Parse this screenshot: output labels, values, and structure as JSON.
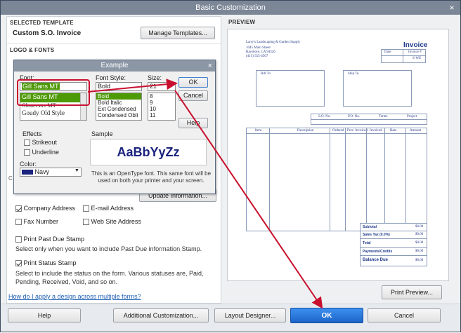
{
  "window": {
    "title": "Basic Customization",
    "close": "×"
  },
  "left": {
    "selected_template_header": "SELECTED TEMPLATE",
    "template_name": "Custom S.O. Invoice",
    "manage_templates": "Manage Templates...",
    "logo_fonts_header": "LOGO & FONTS",
    "update_information": "Update Information...",
    "options": [
      {
        "label": "Company Address",
        "checked": true
      },
      {
        "label": "E-mail Address",
        "checked": false
      },
      {
        "label": "Fax Number",
        "checked": false
      },
      {
        "label": "Web Site Address",
        "checked": false
      }
    ],
    "past_due_label": "Print Past Due Stamp",
    "past_due_checked": false,
    "past_due_desc": "Select only when you want to include Past Due information Stamp.",
    "status_label": "Print Status Stamp",
    "status_checked": true,
    "status_desc": "Select to include the status on the form. Various statuses are, Paid, Pending, Received, Void, and so on.",
    "help_link": "How do I apply a design across multiple forms?",
    "side_letter": "C"
  },
  "preview": {
    "header": "PREVIEW",
    "company": "Larry's Landscaping & Garden Supply",
    "addr1": "1045 Main Street",
    "addr2": "Bayshore, CA 94326",
    "phone": "(415) 555-4567",
    "doc_title": "Invoice",
    "date_label": "Date",
    "invoice_no_label": "Invoice #",
    "date_value": "",
    "invoice_value": "S-WE",
    "bill_to": "Bill To",
    "ship_to": "Ship To",
    "info_cols": [
      "S.O. No.",
      "P.O. No.",
      "Terms",
      "Project"
    ],
    "line_cols": [
      "Item",
      "Description",
      "Ordered",
      "Prev. Invoiced",
      "Invoiced",
      "Rate",
      "Amount"
    ],
    "totals": [
      {
        "label": "Subtotal",
        "value": "$0.00"
      },
      {
        "label": "Sales Tax  (0.0%)",
        "value": "$0.00"
      },
      {
        "label": "Total",
        "value": "$0.00"
      },
      {
        "label": "Payments/Credits",
        "value": "$0.00"
      },
      {
        "label": "Balance Due",
        "value": "$0.00"
      }
    ],
    "print_preview": "Print Preview..."
  },
  "dialog": {
    "title": "Example",
    "close": "×",
    "font_label": "Font:",
    "font_value": "Gill Sans MT",
    "fonts": [
      "Gill Sans MT",
      "Gloucester MT",
      "Goudy Old Style"
    ],
    "style_label": "Font Style:",
    "style_value": "Bold",
    "styles": [
      "Bold",
      "Bold Italic",
      "Ext Condensed",
      "Condensed Obli"
    ],
    "size_label": "Size:",
    "size_value": "21",
    "sizes": [
      "8",
      "9",
      "10",
      "11"
    ],
    "ok": "OK",
    "cancel": "Cancel",
    "help": "Help",
    "effects_label": "Effects",
    "strikeout": "Strikeout",
    "underline": "Underline",
    "color_label": "Color:",
    "color_value": "Navy",
    "sample_label": "Sample",
    "sample_text": "AaBbYyZz",
    "font_note": "This is an OpenType font. This same font will be used on both your printer and your screen."
  },
  "footer": {
    "help": "Help",
    "additional": "Additional Customization...",
    "layout": "Layout Designer...",
    "ok": "OK",
    "cancel": "Cancel"
  },
  "colors": {
    "accent": "#1e6fd9",
    "highlight_red": "#c8102e",
    "selection_green": "#4e9a06",
    "navy": "#1a237e"
  }
}
